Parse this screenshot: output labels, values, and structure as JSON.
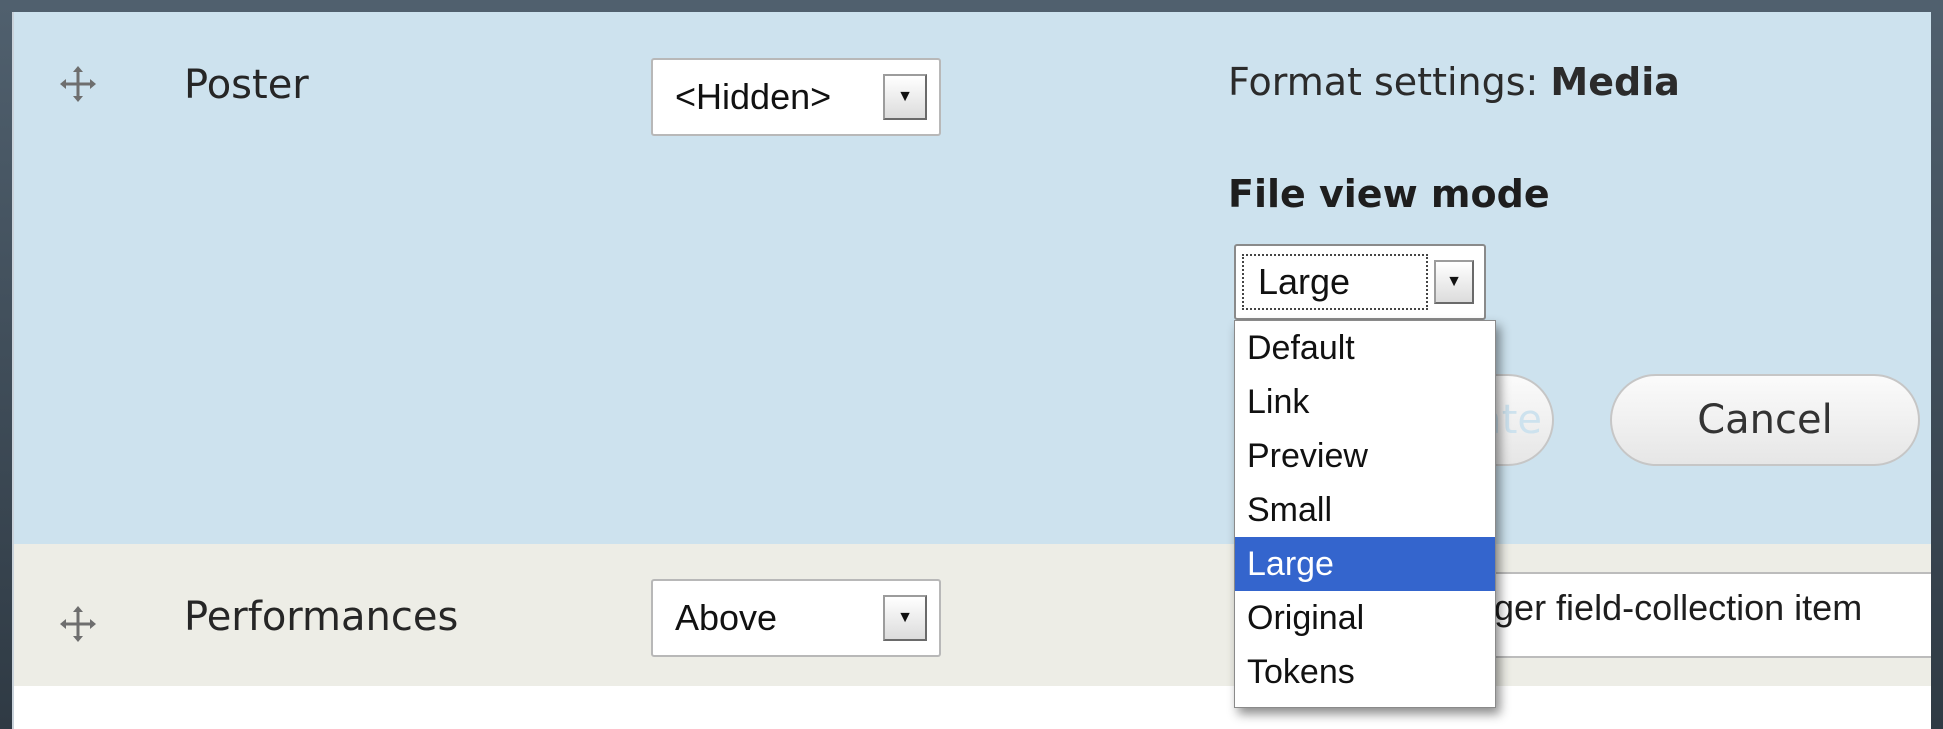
{
  "rows": {
    "poster": {
      "label": "Poster",
      "display_select": "<Hidden>",
      "format_summary_prefix": "Format settings:",
      "format_summary_value": "Media",
      "file_view_mode_label": "File view mode",
      "file_view_mode_value": "Large",
      "update_button": "Update",
      "cancel_button": "Cancel"
    },
    "performances": {
      "label": "Performances",
      "display_select": "Above",
      "format_summary": "ager field-collection item"
    }
  },
  "dropdown": {
    "options": [
      "Default",
      "Link",
      "Preview",
      "Small",
      "Large",
      "Original",
      "Tokens"
    ],
    "selected": "Large"
  },
  "colors": {
    "poster_row_bg": "#cde2ee",
    "performances_row_bg": "#edede6",
    "selected_option_bg": "#3465cd"
  },
  "icons": [
    "drag-handle-icon",
    "select-arrow-icon"
  ]
}
